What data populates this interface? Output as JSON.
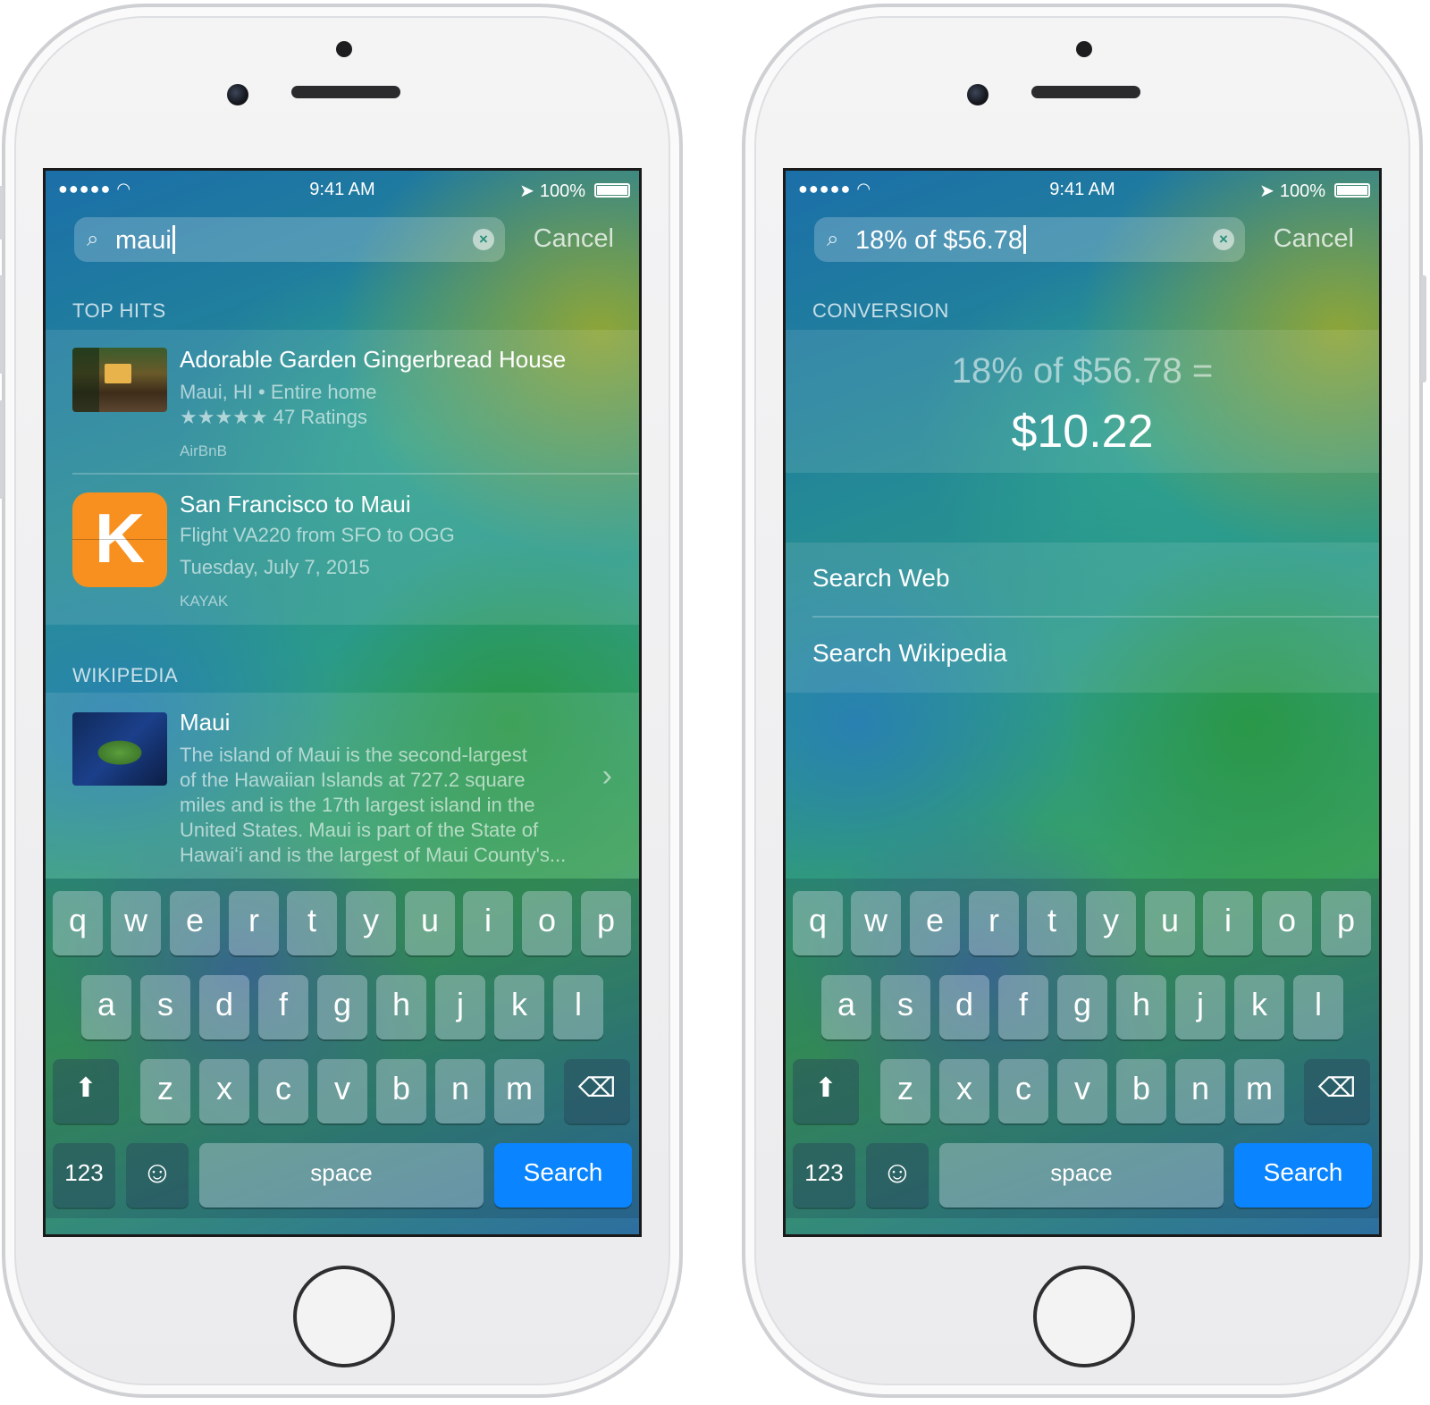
{
  "status": {
    "signal": "●●●●● ",
    "time": "9:41 AM",
    "battery": "100%"
  },
  "keyboard": {
    "row1": [
      "q",
      "w",
      "e",
      "r",
      "t",
      "y",
      "u",
      "i",
      "o",
      "p"
    ],
    "row2": [
      "a",
      "s",
      "d",
      "f",
      "g",
      "h",
      "j",
      "k",
      "l"
    ],
    "row3": [
      "z",
      "x",
      "c",
      "v",
      "b",
      "n",
      "m"
    ],
    "numbers": "123",
    "space": "space",
    "search": "Search"
  },
  "left": {
    "query": "maui",
    "cancel": "Cancel",
    "top_hits_title": "TOP HITS",
    "hits": [
      {
        "title": "Adorable Garden Gingerbread House",
        "sub1": "Maui, HI • Entire home",
        "stars": "★★★★★",
        "sub2": "47 Ratings",
        "source": "AirBnB"
      },
      {
        "title": "San Francisco to Maui",
        "sub1": "Flight VA220 from SFO to OGG",
        "sub2": "Tuesday, July 7, 2015",
        "source": "KAYAK",
        "icon_letter": "K"
      }
    ],
    "wikipedia_title": "WIKIPEDIA",
    "wiki": {
      "title": "Maui",
      "lines": [
        "The island of Maui is the second-largest",
        "of the Hawaiian Islands at 727.2 square",
        "miles and is the 17th largest island in the",
        "United States. Maui is part of the State of",
        "Hawaiʻi and is the largest of Maui County's..."
      ]
    }
  },
  "right": {
    "query": "18% of $56.78",
    "cancel": "Cancel",
    "conversion_title": "CONVERSION",
    "expression": "18% of $56.78 =",
    "result": "$10.22",
    "search_web": "Search Web",
    "search_wikipedia": "Search Wikipedia"
  },
  "colors": {
    "search_key": "#0a84ff",
    "kayak_orange": "#f7901e"
  }
}
